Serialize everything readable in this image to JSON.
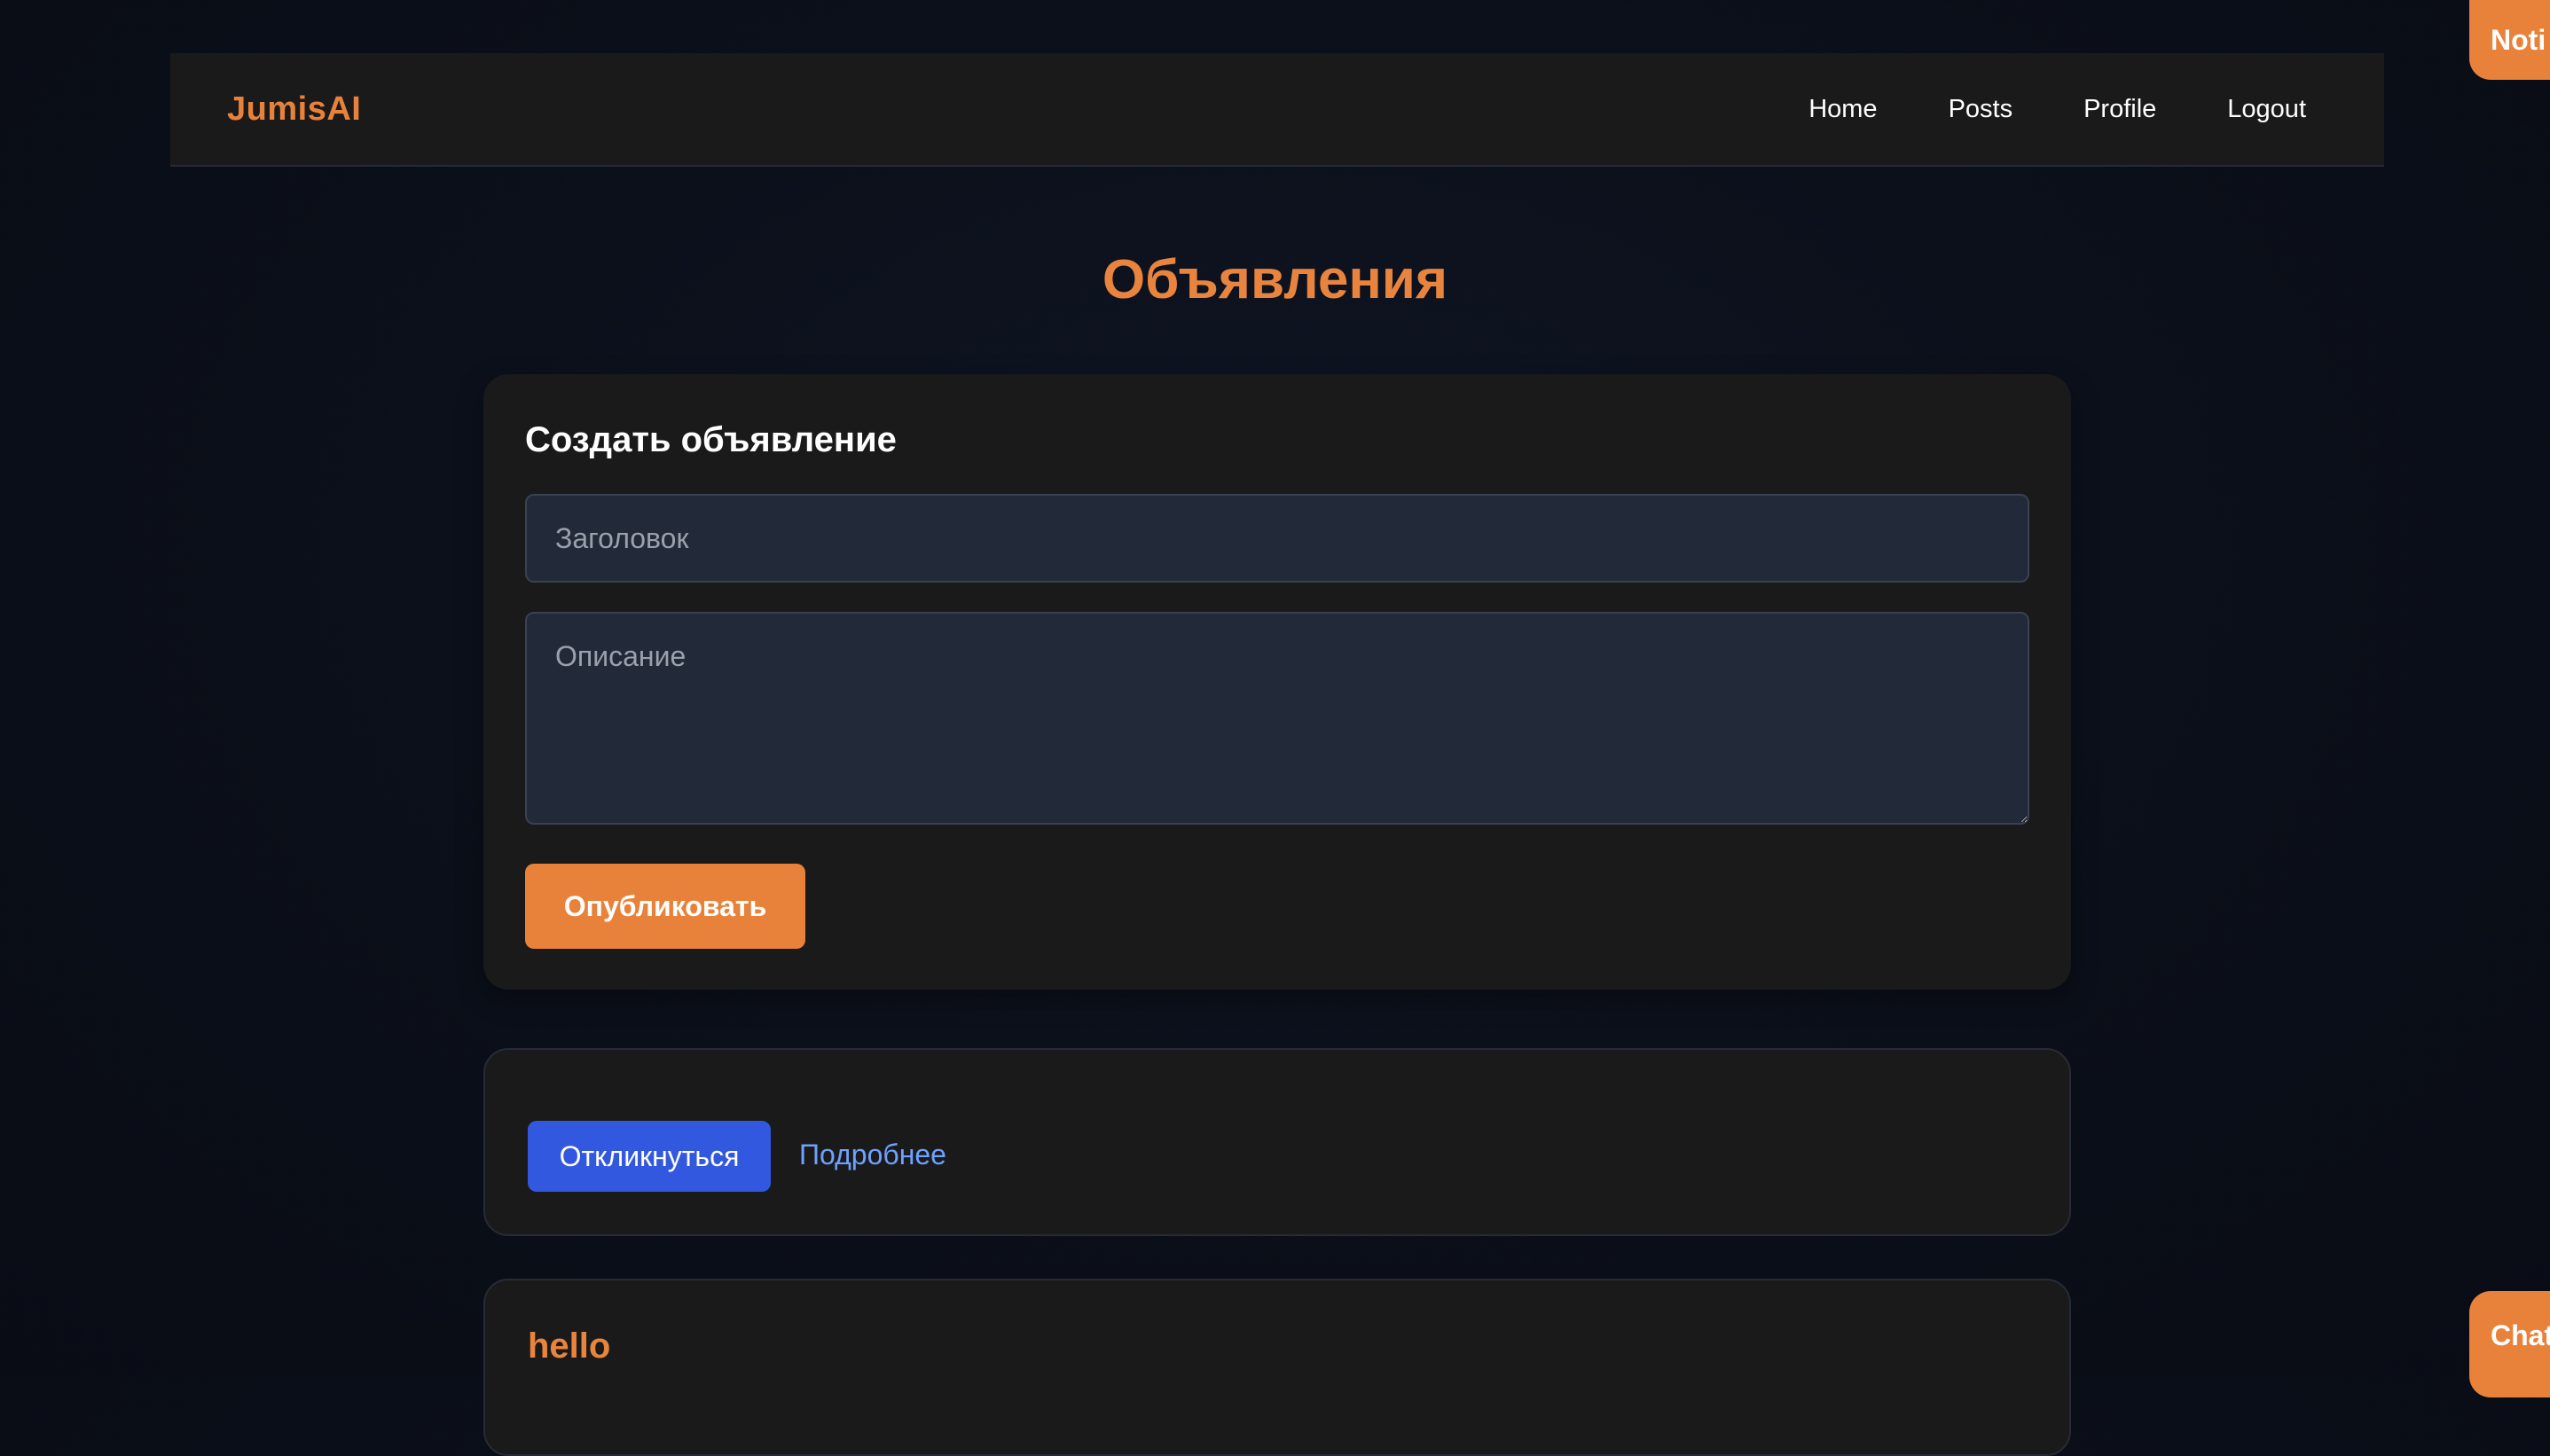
{
  "header": {
    "brand": "JumisAI",
    "nav": [
      "Home",
      "Posts",
      "Profile",
      "Logout"
    ]
  },
  "page": {
    "title": "Объявления"
  },
  "create_form": {
    "heading": "Создать объявление",
    "title_placeholder": "Заголовок",
    "title_value": "",
    "description_placeholder": "Описание",
    "description_value": "",
    "publish_label": "Опубликовать"
  },
  "posts": [
    {
      "title": "",
      "respond_label": "Откликнуться",
      "details_label": "Подробнее"
    },
    {
      "title": "hello"
    }
  ],
  "floating": {
    "notifications_label": "Noti",
    "chat_label": "Chat"
  },
  "colors": {
    "accent": "#e8823a",
    "primary_button": "#3358e0",
    "link": "#6ea2ff",
    "card_bg": "#1a1a1a",
    "page_bg": "#0b0f19",
    "input_bg": "#222938"
  }
}
